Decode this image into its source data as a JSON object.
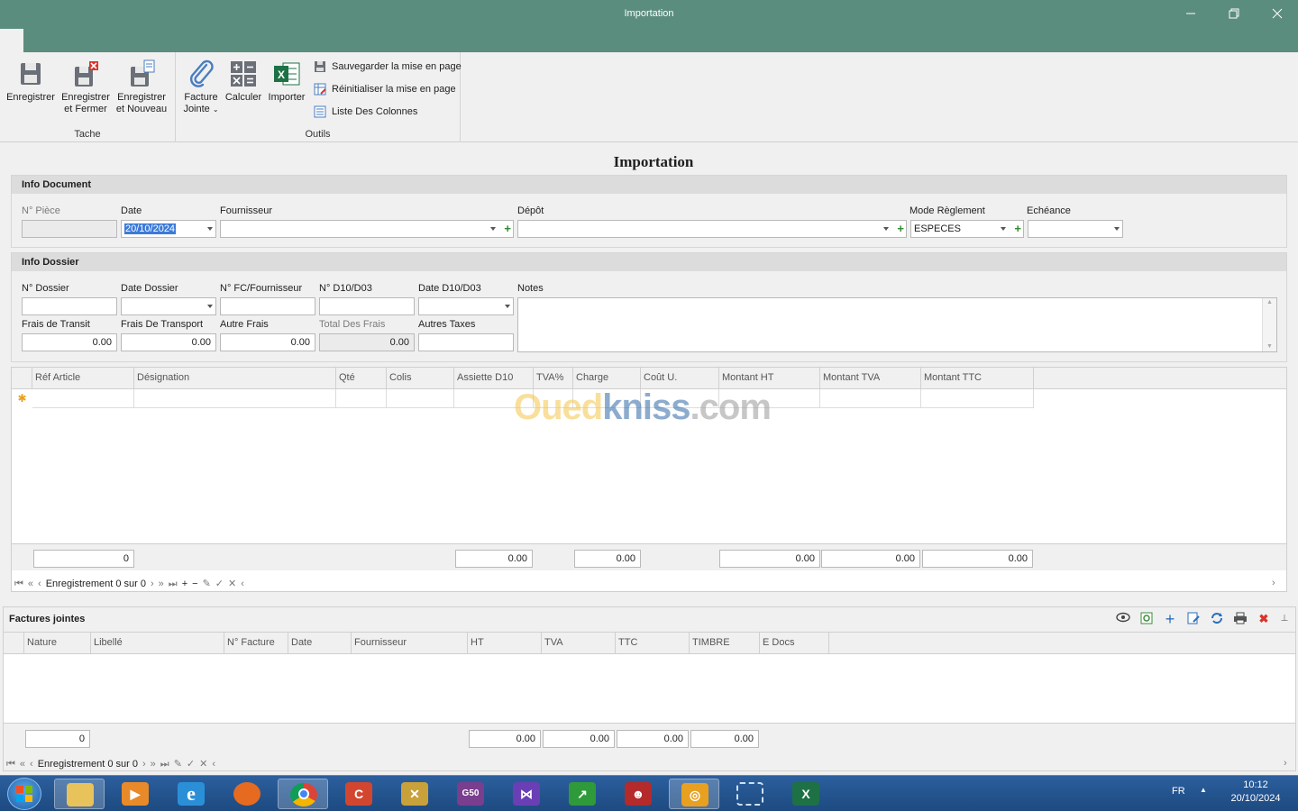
{
  "window": {
    "title": "Importation",
    "minimize_icon": "minimize-icon",
    "restore_icon": "restore-icon",
    "close_icon": "close-icon"
  },
  "ribbon": {
    "groups": [
      {
        "label": "Tache"
      },
      {
        "label": "Outils"
      }
    ],
    "buttons": {
      "enregistrer": {
        "label": "Enregistrer",
        "icon": "save-icon"
      },
      "enregistrer_fermer": {
        "label": "Enregistrer et Fermer",
        "line1": "Enregistrer",
        "line2": "et Fermer",
        "icon": "save-close-icon"
      },
      "enregistrer_nouveau": {
        "label": "Enregistrer et Nouveau",
        "line1": "Enregistrer",
        "line2": "et Nouveau",
        "icon": "save-new-icon"
      },
      "facture_jointe": {
        "label": "Facture Jointe",
        "line1": "Facture",
        "line2": "Jointe",
        "icon": "paperclip-icon"
      },
      "calculer": {
        "label": "Calculer",
        "icon": "calculator-icon"
      },
      "importer": {
        "label": "Importer",
        "icon": "excel-icon"
      },
      "sauvegarder": {
        "label": "Sauvegarder la mise en page",
        "icon": "save-layout-icon"
      },
      "reinitialiser": {
        "label": "Réinitialiser la mise en page",
        "icon": "reset-layout-icon"
      },
      "liste_colonnes": {
        "label": "Liste Des Colonnes",
        "icon": "column-list-icon"
      }
    }
  },
  "page": {
    "title": "Importation"
  },
  "info_document": {
    "header": "Info Document",
    "n_piece": {
      "label": "N° Pièce",
      "value": ""
    },
    "date": {
      "label": "Date",
      "value": "20/10/2024"
    },
    "fournisseur": {
      "label": "Fournisseur",
      "value": ""
    },
    "depot": {
      "label": "Dépôt",
      "value": ""
    },
    "mode_reglement": {
      "label": "Mode Règlement",
      "value": "ESPECES"
    },
    "echeance": {
      "label": "Echéance",
      "value": ""
    }
  },
  "info_dossier": {
    "header": "Info Dossier",
    "n_dossier": {
      "label": "N° Dossier",
      "value": ""
    },
    "date_dossier": {
      "label": "Date Dossier",
      "value": ""
    },
    "n_fc_fournisseur": {
      "label": "N° FC/Fournisseur",
      "value": ""
    },
    "n_d10": {
      "label": "N° D10/D03",
      "value": ""
    },
    "date_d10": {
      "label": "Date D10/D03",
      "value": ""
    },
    "notes": {
      "label": "Notes",
      "value": ""
    },
    "frais_transit": {
      "label": "Frais de Transit",
      "value": "0.00"
    },
    "frais_transport": {
      "label": "Frais De Transport",
      "value": "0.00"
    },
    "autre_frais": {
      "label": "Autre Frais",
      "value": "0.00"
    },
    "total_frais": {
      "label": "Total Des Frais",
      "value": "0.00"
    },
    "autres_taxes": {
      "label": "Autres Taxes",
      "value": ""
    }
  },
  "articles_grid": {
    "columns": [
      "Réf Article",
      "Désignation",
      "Qté",
      "Colis",
      "Assiette D10",
      "TVA%",
      "Charge",
      "Coût U.",
      "Montant HT",
      "Montant TVA",
      "Montant TTC"
    ],
    "new_row_icon": "new-row-star-icon",
    "totals": {
      "count": "0",
      "assiette_d10": "0.00",
      "charge": "0.00",
      "montant_ht": "0.00",
      "montant_tva": "0.00",
      "montant_ttc": "0.00"
    },
    "navigator": {
      "text": "Enregistrement 0 sur 0"
    }
  },
  "watermark": {
    "part1": "Oued",
    "part2": "kniss",
    "part3": ".com"
  },
  "factures_jointes": {
    "title": "Factures jointes",
    "toolbar_icons": [
      "eye-icon",
      "refresh-list-icon",
      "add-icon",
      "edit-icon",
      "reload-icon",
      "print-icon",
      "delete-icon",
      "pin-icon"
    ],
    "columns": [
      "Nature",
      "Libellé",
      "N° Facture",
      "Date",
      "Fournisseur",
      "HT",
      "TVA",
      "TTC",
      "TIMBRE",
      "E Docs"
    ],
    "totals": {
      "count": "0",
      "ht": "0.00",
      "tva": "0.00",
      "ttc": "0.00",
      "timbre": "0.00"
    },
    "navigator": {
      "text": "Enregistrement 0 sur 0"
    }
  },
  "taskbar": {
    "apps": [
      "windows-start-icon",
      "file-explorer-icon",
      "media-player-icon",
      "internet-explorer-icon",
      "firefox-icon",
      "chrome-icon",
      "ccleaner-icon",
      "tools-icon",
      "pos-app-icon",
      "visual-studio-icon",
      "chart-app-icon",
      "team-app-icon",
      "erp-app-icon",
      "screenshot-icon",
      "excel-icon"
    ],
    "language": "FR",
    "time": "10:12",
    "date": "20/10/2024"
  }
}
